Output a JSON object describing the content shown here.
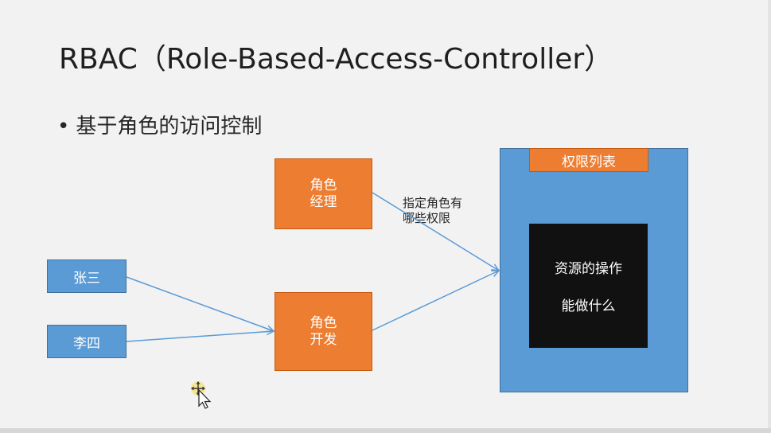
{
  "title": "RBAC（Role-Based-Access-Controller）",
  "bullet": {
    "marker": "•",
    "text": "基于角色的访问控制"
  },
  "users": {
    "zhangsan": "张三",
    "lisi": "李四"
  },
  "roles": {
    "manager": {
      "line1": "角色",
      "line2": "经理"
    },
    "developer": {
      "line1": "角色",
      "line2": "开发"
    }
  },
  "annotation": {
    "line1": "指定角色有",
    "line2": "哪些权限"
  },
  "permissions": {
    "header": "权限列表",
    "resource_line1": "资源的操作",
    "resource_line2": "能做什么"
  },
  "colors": {
    "orange": "#ed7d31",
    "blue": "#5b9bd5",
    "arrow": "#5b9bd5",
    "dark": "#111111"
  },
  "icons": {
    "cursor": "move-cursor-icon"
  }
}
